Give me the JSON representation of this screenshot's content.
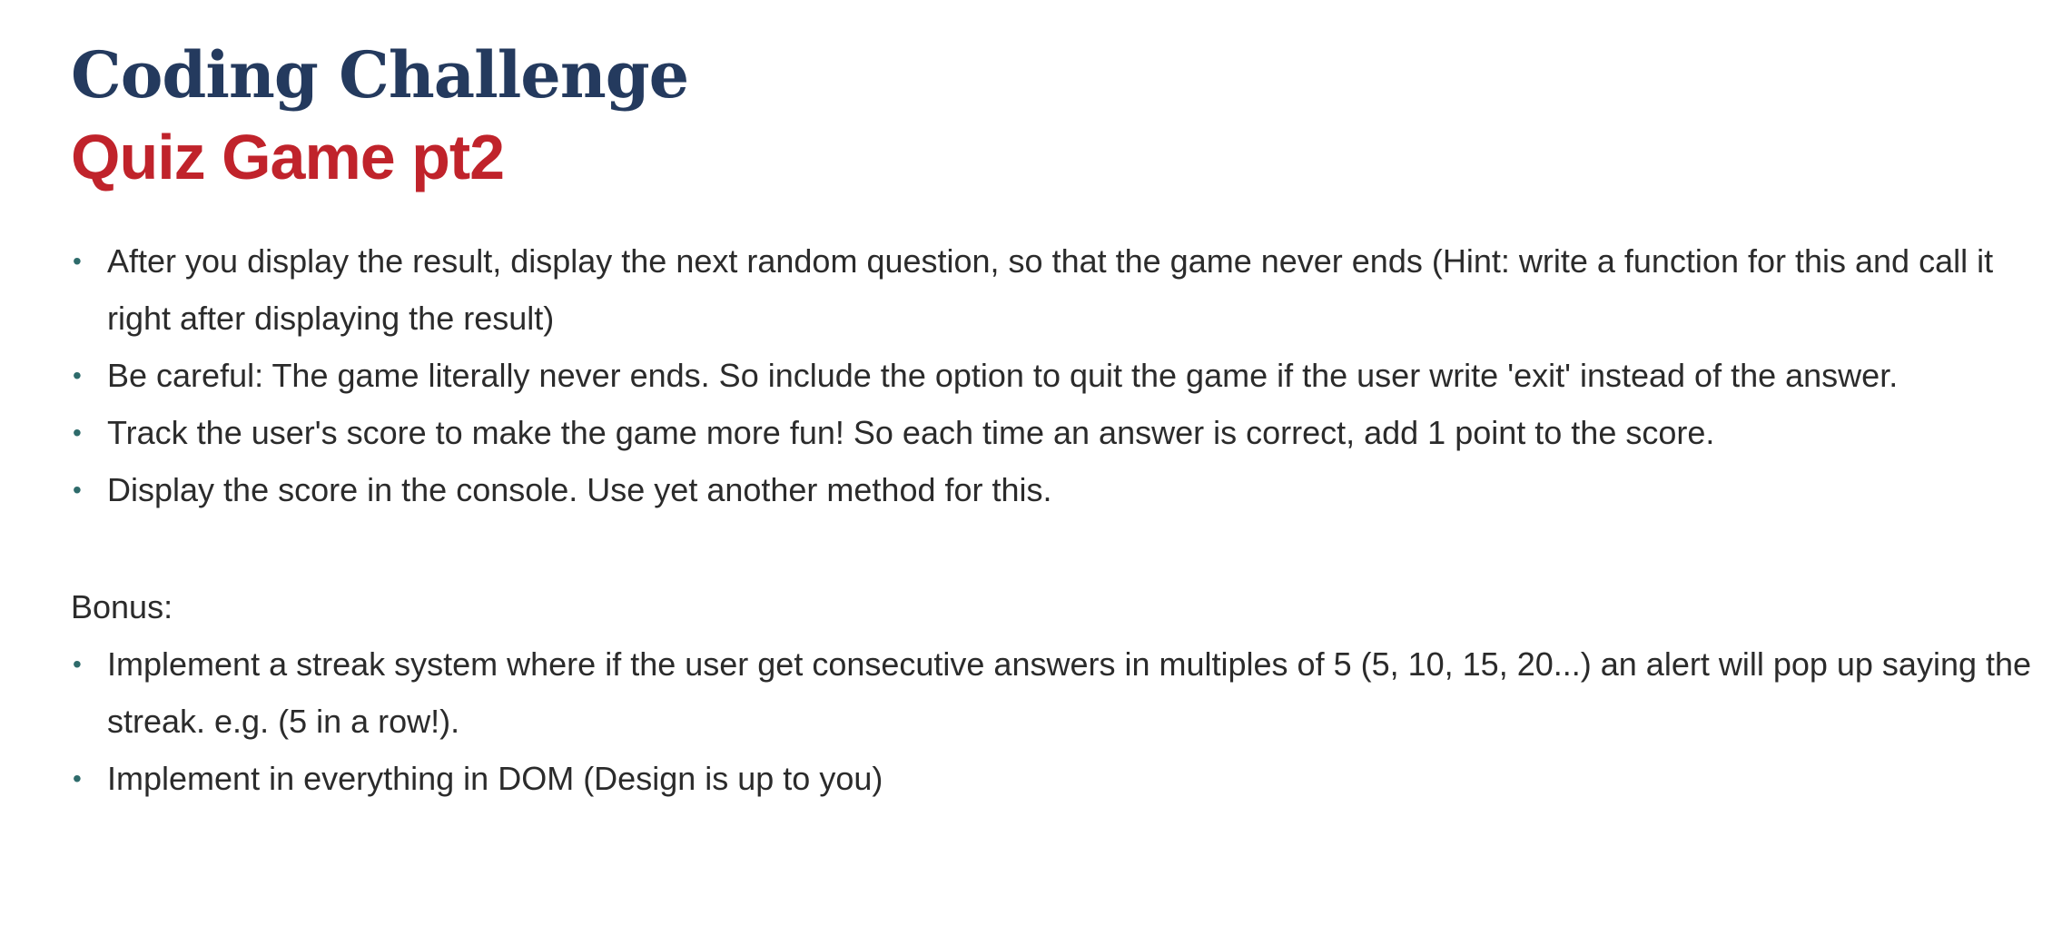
{
  "header": {
    "title": "Coding Challenge",
    "subtitle": "Quiz Game pt2"
  },
  "tasks": [
    "After you display the result, display the next random question, so that the game never ends (Hint: write a function for this and call it right after displaying the result)",
    "Be careful: The game literally never ends. So include the option to quit the game if the user write 'exit' instead of the answer.",
    "Track the user's score to make the game more fun! So each time an answer is correct, add 1 point to the score.",
    "Display the score in the console. Use yet another method for this."
  ],
  "bonus": {
    "label": "Bonus:",
    "items": [
      "Implement a streak system where if the user get consecutive answers in multiples of 5 (5, 10, 15, 20...) an alert will pop up saying the streak. e.g. (5 in a row!).",
      "Implement in everything in DOM (Design is up to you)"
    ]
  },
  "colors": {
    "title": "#243a5e",
    "subtitle": "#c0232b",
    "bullet": "#2e6b6b",
    "text": "#2b2b2b"
  }
}
